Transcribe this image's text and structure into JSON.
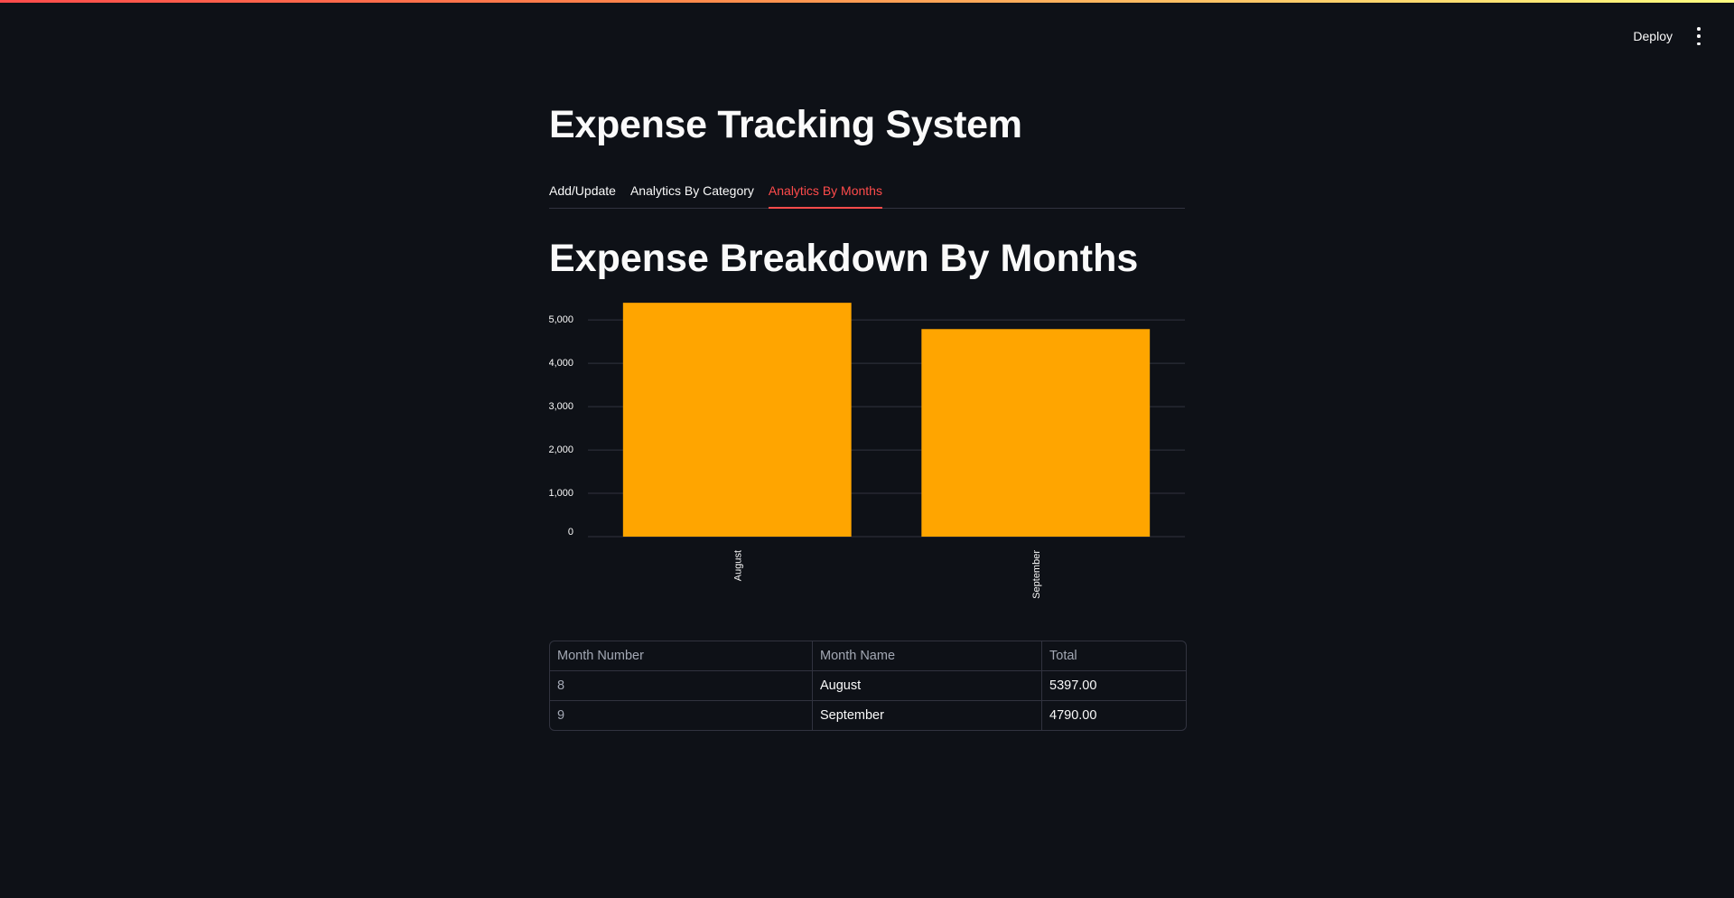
{
  "header": {
    "deploy_label": "Deploy",
    "menu_icon": "vertical-ellipsis-icon"
  },
  "page": {
    "title": "Expense Tracking System"
  },
  "tabs": [
    {
      "label": "Add/Update",
      "active": false
    },
    {
      "label": "Analytics By Category",
      "active": false
    },
    {
      "label": "Analytics By Months",
      "active": true
    }
  ],
  "section": {
    "title": "Expense Breakdown By Months"
  },
  "colors": {
    "accent": "#ff4b4b",
    "bar": "#ffa500",
    "background": "#0e1117"
  },
  "chart_data": {
    "type": "bar",
    "categories": [
      "August",
      "September"
    ],
    "values": [
      5397,
      4790
    ],
    "ylim": [
      0,
      5400
    ],
    "yticks": [
      0,
      1000,
      2000,
      3000,
      4000,
      5000
    ],
    "ytick_labels": [
      "0",
      "1,000",
      "2,000",
      "3,000",
      "4,000",
      "5,000"
    ],
    "grid": true,
    "title": "",
    "xlabel": "",
    "ylabel": ""
  },
  "table": {
    "columns": [
      "Month Number",
      "Month Name",
      "Total"
    ],
    "rows": [
      [
        "8",
        "August",
        "5397.00"
      ],
      [
        "9",
        "September",
        "4790.00"
      ]
    ]
  }
}
